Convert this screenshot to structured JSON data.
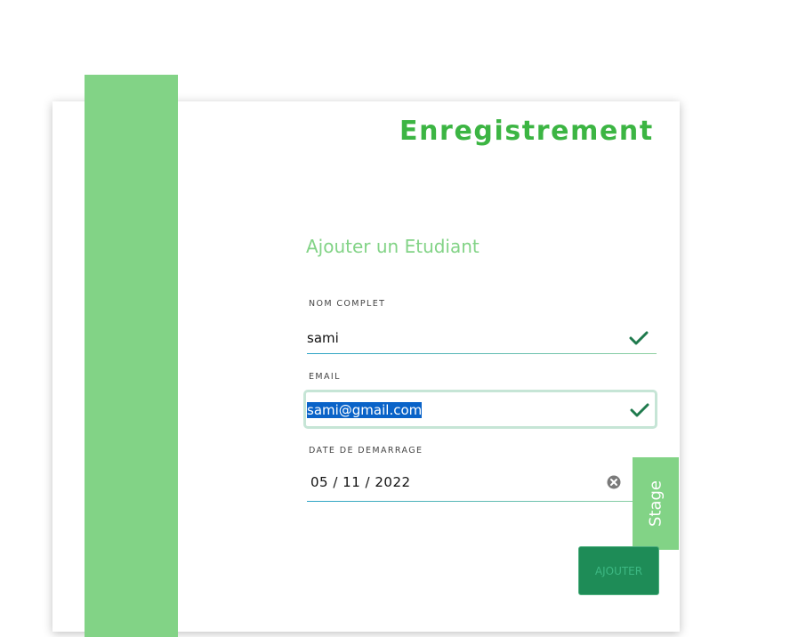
{
  "page": {
    "title": "Enregistrement",
    "subtitle": "Ajouter un Etudiant"
  },
  "form": {
    "name": {
      "label": "NOM COMPLET",
      "value": "sami",
      "valid": true
    },
    "email": {
      "label": "EMAIL",
      "value": "sami@gmail.com",
      "valid": true,
      "selected": true
    },
    "date": {
      "label": "DATE DE DEMARRAGE",
      "value": "05 / 11 / 2022"
    },
    "submit_label": "AJOUTER"
  },
  "side_tab": {
    "label": "Stage"
  },
  "icons": {
    "valid": "check-icon",
    "clear": "clear-circle-icon"
  },
  "colors": {
    "accent_green": "#82d386",
    "title_green": "#3cb543",
    "button_green": "#1e8c57",
    "check_green": "#1f7a4d",
    "selection_blue": "#0a63c8"
  }
}
